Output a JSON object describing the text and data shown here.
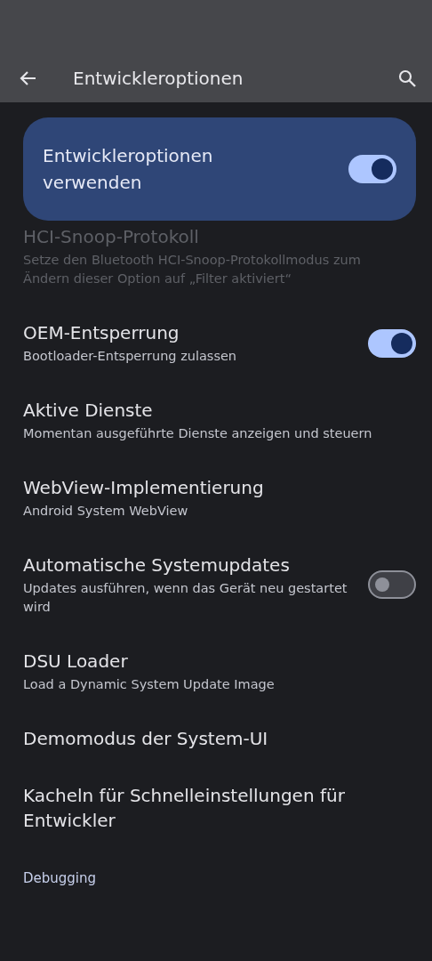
{
  "app_bar": {
    "title": "Entwickleroptionen"
  },
  "main_switch": {
    "label": "Entwickleroptionen verwenden",
    "on": true
  },
  "items": [
    {
      "kind": "plain",
      "title": "HCI-Snoop-Protokoll",
      "subtitle": "Setze den Bluetooth HCI-Snoop-Protokollmodus zum Ändern dieser Option auf „Filter aktiviert“",
      "disabled": true
    },
    {
      "kind": "switch",
      "title": "OEM-Entsperrung",
      "subtitle": "Bootloader-Entsperrung zulassen",
      "disabled": false,
      "on": true
    },
    {
      "kind": "plain",
      "title": "Aktive Dienste",
      "subtitle": "Momentan ausgeführte Dienste anzeigen und steuern",
      "disabled": false
    },
    {
      "kind": "plain",
      "title": "WebView-Implementierung",
      "subtitle": "Android System WebView",
      "disabled": false
    },
    {
      "kind": "switch",
      "title": "Automatische Systemupdates",
      "subtitle": "Updates ausführen, wenn das Gerät neu gestartet wird",
      "disabled": false,
      "on": false
    },
    {
      "kind": "plain",
      "title": "DSU Loader",
      "subtitle": "Load a Dynamic System Update Image",
      "disabled": false
    },
    {
      "kind": "plain",
      "title": "Demomodus der System-UI",
      "disabled": false
    },
    {
      "kind": "plain",
      "title": "Kacheln für Schnelleinstellungen für Entwickler",
      "disabled": false
    }
  ],
  "section_header": "Debugging"
}
